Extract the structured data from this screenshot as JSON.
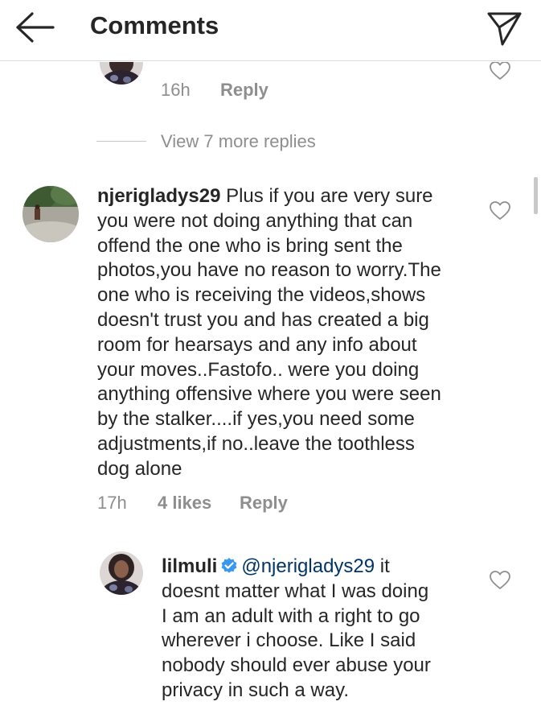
{
  "header": {
    "title": "Comments",
    "back_icon": "arrow-left-icon",
    "send_icon": "paper-plane-icon"
  },
  "colors": {
    "text": "#262626",
    "meta": "#8e8e8e",
    "mention": "#003569",
    "verified": "#3897f0",
    "border": "#dbdbdb"
  },
  "reply_top": {
    "time": "16h",
    "reply_label": "Reply"
  },
  "view_more": {
    "label": "View 7 more replies"
  },
  "comment_main": {
    "username": "njerigladys29",
    "lines": [
      "Plus if you are very sure",
      "you were not doing anything that can",
      "offend the one who is bring sent the",
      "photos,you have no reason to worry.The",
      "one who is receiving the videos,shows",
      "doesn't trust you and has created a big",
      "room for hearsays and any info about",
      "your moves..Fastofo.. were you doing",
      "anything offensive where you were seen",
      "by the stalker....if yes,you need some",
      "adjustments,if no..leave the toothless",
      "dog alone"
    ],
    "time": "17h",
    "likes": "4 likes",
    "reply_label": "Reply"
  },
  "reply_bottom": {
    "username": "lilmuli",
    "mention": "@njerigladys29",
    "lines": [
      " it",
      "doesnt matter what I was doing",
      "I am an adult with a right to go",
      "wherever i choose. Like I said",
      "nobody should ever abuse your",
      "privacy in such a way."
    ]
  }
}
